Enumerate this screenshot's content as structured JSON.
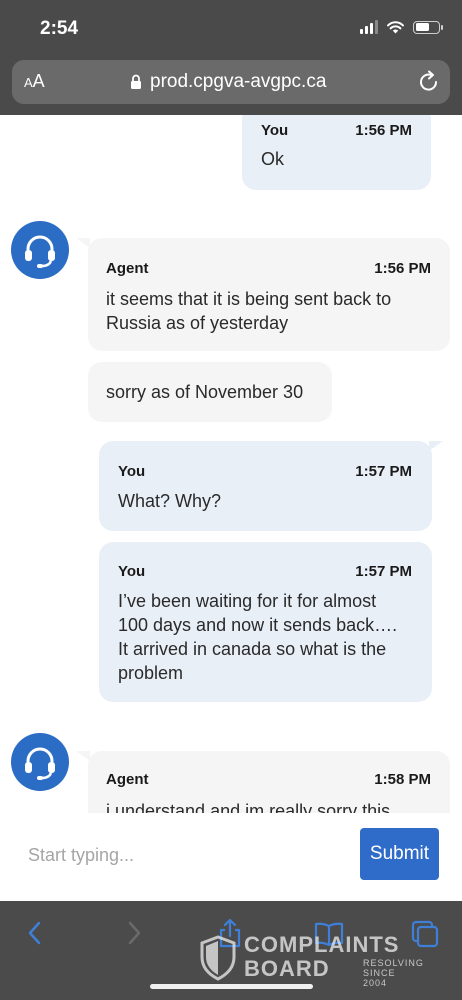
{
  "status_bar": {
    "time": "2:54"
  },
  "browser": {
    "text_size_label_small": "A",
    "text_size_label_large": "A",
    "url": "prod.cpgva-avgpc.ca"
  },
  "messages": [
    {
      "sender": "You",
      "time": "1:56 PM",
      "text": "Ok"
    },
    {
      "sender": "Agent",
      "time": "1:56 PM",
      "text": "it seems that it is being sent back to Russia as of yesterday"
    },
    {
      "sender": "",
      "time": "",
      "text": "sorry as of November 30"
    },
    {
      "sender": "You",
      "time": "1:57 PM",
      "text": "What? Why?"
    },
    {
      "sender": "You",
      "time": "1:57 PM",
      "text": "I’ve been waiting for it for almost 100 days and now it sends back…. It arrived in canada so what is the problem"
    },
    {
      "sender": "Agent",
      "time": "1:58 PM",
      "text": "i understand and im really sorry this"
    }
  ],
  "composer": {
    "placeholder": "Start typing...",
    "submit_label": "Submit"
  },
  "toolbar": {
    "icons": [
      "back-icon",
      "forward-icon",
      "share-icon",
      "bookmarks-icon",
      "tabs-icon"
    ]
  },
  "watermark": {
    "line1": "COMPLAINTS",
    "line2": "BOARD",
    "tagline_1": "RESOLVING",
    "tagline_2": "SINCE 2004"
  },
  "colors": {
    "accent": "#2f6bc9",
    "you_bubble": "#e9eff7",
    "agent_bubble": "#f5f5f5",
    "chrome": "#4a4a4a"
  }
}
